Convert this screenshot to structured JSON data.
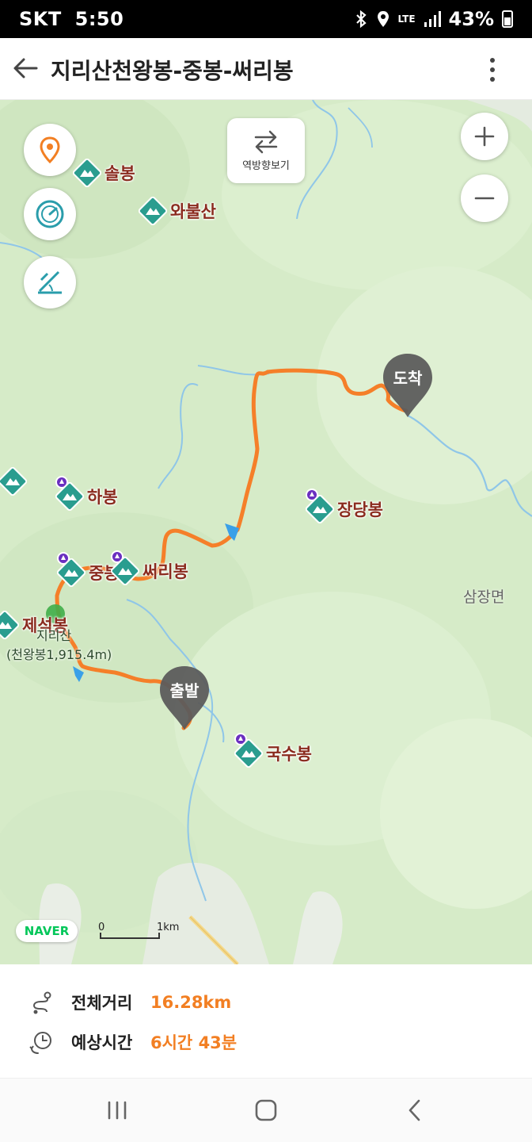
{
  "status_bar": {
    "carrier": "SKT",
    "time": "5:50",
    "network": "LTE",
    "battery": "43%"
  },
  "header": {
    "title": "지리산천왕봉-중봉-써리봉"
  },
  "map": {
    "reverse_button_label": "역방향보기",
    "peaks": [
      {
        "name": "솔봉"
      },
      {
        "name": "와불산"
      },
      {
        "name": "하봉"
      },
      {
        "name": "장당봉"
      },
      {
        "name": "중봉"
      },
      {
        "name": "써리봉"
      },
      {
        "name": "제석봉"
      },
      {
        "name": "국수봉"
      }
    ],
    "region_label": "삼장면",
    "jirisan_label": "지리산",
    "jirisan_sub_label": "(천왕봉1,915.4m)",
    "start_pin": "출발",
    "end_pin": "도착",
    "logo": "NAVER",
    "scale_start": "0",
    "scale_end": "1km",
    "colors": {
      "route": "#f57f29",
      "map_bg": "#d6ebc8",
      "pin": "#5c5c5c",
      "peak_icon": "#2a9d8f"
    }
  },
  "summary": {
    "distance_label": "전체거리",
    "distance_value": "16.28km",
    "time_label": "예상시간",
    "time_value": "6시간 43분",
    "accent_color": "#f27f23"
  }
}
